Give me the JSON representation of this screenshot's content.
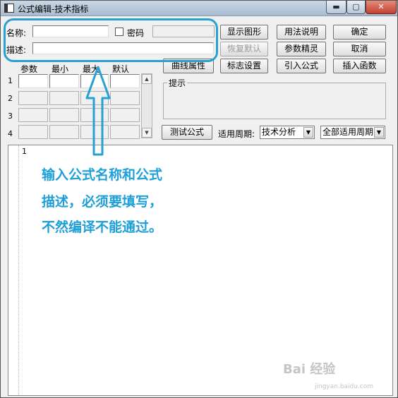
{
  "window": {
    "title": "公式编辑-技术指标",
    "controls": {
      "minimize": "▬",
      "maximize": "▢",
      "close": "✕"
    }
  },
  "form": {
    "name_label": "名称:",
    "name_value": "",
    "password_label": "密码",
    "password_value": "",
    "desc_label": "描述:",
    "desc_value": ""
  },
  "params": {
    "headers": [
      "参数",
      "最小",
      "最大",
      "默认"
    ],
    "rows": [
      "1",
      "2",
      "3",
      "4"
    ]
  },
  "buttons": {
    "show_graph": "显示图形",
    "usage": "用法说明",
    "ok": "确定",
    "restore_default": "恢复默认",
    "param_wizard": "参数精灵",
    "cancel": "取消",
    "curve_props": "曲线属性",
    "marker_settings": "标志设置",
    "import_formula": "引入公式",
    "insert_function": "插入函数",
    "test_formula": "测试公式"
  },
  "hint": {
    "label": "提示"
  },
  "period": {
    "label": "适用周期:",
    "type_value": "技术分析",
    "period_value": "全部适用周期"
  },
  "editor": {
    "line_number": "1"
  },
  "annotation": {
    "lines": [
      "输入公式名称和公式",
      "描述，必须要填写，",
      "不然编译不能通过。"
    ],
    "color": "#1e9fd8"
  },
  "watermark": {
    "text": "Bai 经验",
    "url": "jingyan.baidu.com"
  }
}
